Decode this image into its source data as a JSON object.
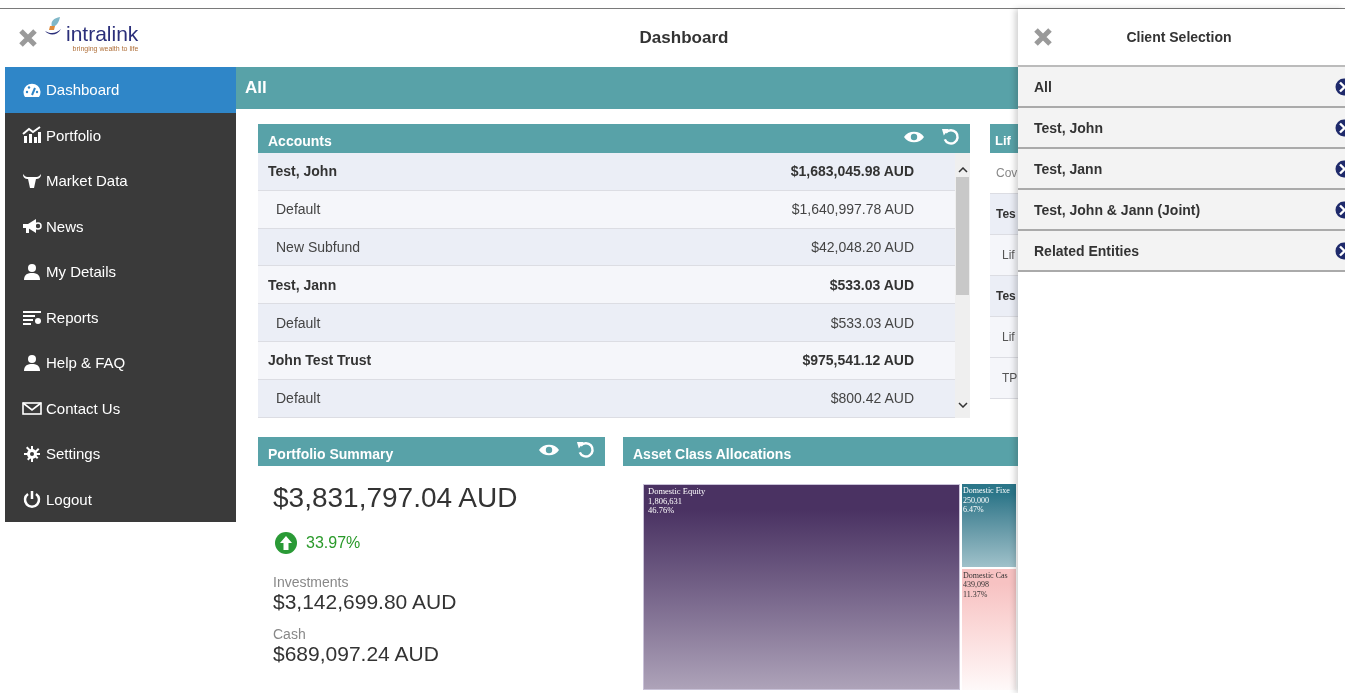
{
  "header": {
    "title": "Dashboard",
    "logo": {
      "name": "intralink",
      "tagline": "bringing wealth to life"
    }
  },
  "sidebar": {
    "items": [
      {
        "label": "Dashboard",
        "kind": "dashboard",
        "selected": true
      },
      {
        "label": "Portfolio",
        "kind": "chart",
        "selected": false
      },
      {
        "label": "Market Data",
        "kind": "bull",
        "selected": false
      },
      {
        "label": "News",
        "kind": "megaphone",
        "selected": false
      },
      {
        "label": "My Details",
        "kind": "person",
        "selected": false
      },
      {
        "label": "Reports",
        "kind": "list",
        "selected": false
      },
      {
        "label": "Help & FAQ",
        "kind": "person",
        "selected": false
      },
      {
        "label": "Contact Us",
        "kind": "mail",
        "selected": false
      },
      {
        "label": "Settings",
        "kind": "gear",
        "selected": false
      },
      {
        "label": "Logout",
        "kind": "power",
        "selected": false
      }
    ]
  },
  "filter_bar": {
    "title": "All"
  },
  "accounts": {
    "title": "Accounts",
    "rows": [
      {
        "kind": "group",
        "name": "Test, John",
        "amount": "$1,683,045.98 AUD"
      },
      {
        "kind": "sub",
        "name": "Default",
        "amount": "$1,640,997.78 AUD"
      },
      {
        "kind": "sub",
        "name": "New Subfund",
        "amount": "$42,048.20 AUD"
      },
      {
        "kind": "group",
        "name": "Test, Jann",
        "amount": "$533.03 AUD"
      },
      {
        "kind": "sub",
        "name": "Default",
        "amount": "$533.03 AUD"
      },
      {
        "kind": "group",
        "name": "John Test Trust",
        "amount": "$975,541.12 AUD"
      },
      {
        "kind": "sub",
        "name": "Default",
        "amount": "$800.42 AUD"
      }
    ]
  },
  "life_panel": {
    "title": "Lif",
    "rows": [
      {
        "kind": "note",
        "text": "Cov"
      },
      {
        "kind": "group",
        "text": "Tes"
      },
      {
        "kind": "sub",
        "text": "Lif"
      },
      {
        "kind": "group",
        "text": "Tes"
      },
      {
        "kind": "sub",
        "text": "Lif"
      },
      {
        "kind": "sub",
        "text": "TP"
      }
    ]
  },
  "portfolio_summary": {
    "title": "Portfolio Summary",
    "total": "$3,831,797.04 AUD",
    "change": "33.97%",
    "investments_label": "Investments",
    "investments": "$3,142,699.80 AUD",
    "cash_label": "Cash",
    "cash": "$689,097.24 AUD"
  },
  "asset_allocations": {
    "title": "Asset Class Allocations",
    "tiles": [
      {
        "name": "Domestic Equity",
        "value": "1,806,631",
        "share": "46.76%",
        "color": "#4a3262"
      },
      {
        "name": "Domestic Fixe",
        "value": "250,000",
        "share": "6.47%",
        "color": "#2b7689"
      },
      {
        "name": "Domestic Cas",
        "value": "439,098",
        "share": "11.37%",
        "color": "#f7c2c2"
      }
    ]
  },
  "client_selection": {
    "title": "Client Selection",
    "items": [
      {
        "label": "All"
      },
      {
        "label": "Test, John"
      },
      {
        "label": "Test, Jann"
      },
      {
        "label": "Test, John & Jann (Joint)"
      },
      {
        "label": "Related Entities"
      }
    ]
  }
}
